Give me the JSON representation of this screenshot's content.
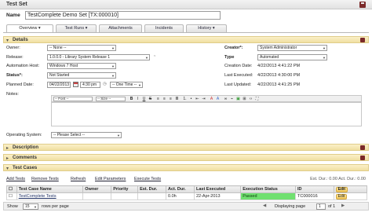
{
  "header": {
    "title": "Test Set",
    "save_icon": "save-icon"
  },
  "name": {
    "label": "Name",
    "value": "TestComplete Demo Set [TX:000010]"
  },
  "tabs": [
    {
      "label": "Overview ▾"
    },
    {
      "label": "Test Runs ▾"
    },
    {
      "label": "Attachments"
    },
    {
      "label": "Incidents"
    },
    {
      "label": "History ▾"
    }
  ],
  "details": {
    "title": "Details",
    "owner_label": "Owner:",
    "owner_value": "-- None --",
    "release_label": "Release:",
    "release_value": "1.0.0.0 - Library System Release 1",
    "automation_host_label": "Automation Host:",
    "automation_host_value": "Windows 7 Host",
    "status_label": "Status*:",
    "status_value": "Not Started",
    "planned_date_label": "Planned Date:",
    "planned_date_value": "04/22/2013",
    "planned_time_value": "4:30 pm",
    "one_time_value": "-- One Time --",
    "notes_label": "Notes:",
    "creator_label": "Creator*:",
    "creator_value": "System Administrator",
    "type_label": "Type",
    "type_value": "Automated",
    "creation_date_label": "Creation Date:",
    "creation_date_value": "4/22/2013 4:41:22 PM",
    "last_executed_label": "Last Executed:",
    "last_executed_value": "4/22/2013 4:30:00 PM",
    "last_updated_label": "Last Updated:",
    "last_updated_value": "4/22/2013 4:41:25 PM",
    "operating_system_label": "Operating System:",
    "operating_system_value": "-- Please Select --",
    "font_value": "-- Font --",
    "size_value": "-- Size --"
  },
  "sections": {
    "description": "Description",
    "comments": "Comments",
    "test_cases": "Test Cases"
  },
  "grid_toolbar": {
    "add": "Add Tests",
    "remove": "Remove Tests",
    "refresh": "Refresh",
    "edit_params": "Edit Parameters",
    "execute": "Execute Tests",
    "summary": "Est. Dur.: 0.00    Act. Dur.: 0.00"
  },
  "table": {
    "headers": [
      "",
      "Test Case Name",
      "Owner",
      "Priority",
      "Est. Dur.",
      "Act. Dur.",
      "Last Executed",
      "Execution Status",
      "ID",
      ""
    ],
    "rows": [
      {
        "name": "TestComplete Tests",
        "owner": "",
        "priority": "",
        "est": "",
        "act": "0.0h",
        "last": "22-Apr-2013",
        "status": "Passed",
        "id": "TC000016",
        "edit": "Edit"
      }
    ],
    "filter_edit": "Edit"
  },
  "pager": {
    "show_label": "Show",
    "show_value": "15",
    "rows_per_page": "rows per page",
    "displaying": "Displaying page",
    "page": "1",
    "of": "of 1"
  }
}
